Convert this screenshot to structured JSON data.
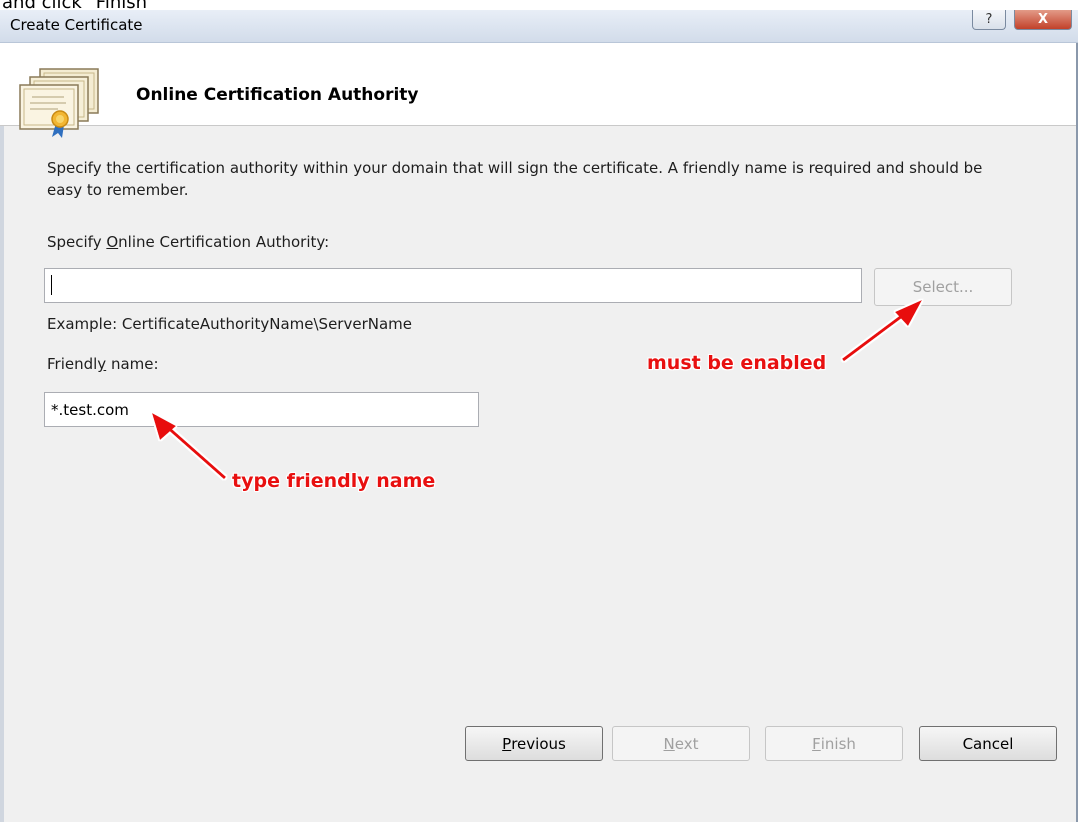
{
  "outer_text": "and click \"Finish\"",
  "window": {
    "title": "Create Certificate",
    "help_glyph": "?",
    "close_glyph": "X"
  },
  "header": {
    "title": "Online Certification Authority"
  },
  "description": "Specify the certification authority within your domain that will sign the certificate. A friendly name is required and should be easy to remember.",
  "ca": {
    "label_pre": "Specify ",
    "label_accel": "O",
    "label_post": "nline Certification Authority:",
    "value": "",
    "select_label": "Select...",
    "example": "Example: CertificateAuthorityName\\ServerName"
  },
  "friendly": {
    "label_pre": "Friendl",
    "label_accel": "y",
    "label_post": " name:",
    "value": "*.test.com"
  },
  "annotations": {
    "select_note": "must be enabled",
    "name_note": "type friendly name"
  },
  "buttons": {
    "previous_accel": "P",
    "previous_rest": "revious",
    "next_accel": "N",
    "next_rest": "ext",
    "finish_accel": "F",
    "finish_rest": "inish",
    "cancel": "Cancel"
  },
  "colors": {
    "annotation": "#e81010",
    "dialog_bg": "#f0f0f0"
  }
}
